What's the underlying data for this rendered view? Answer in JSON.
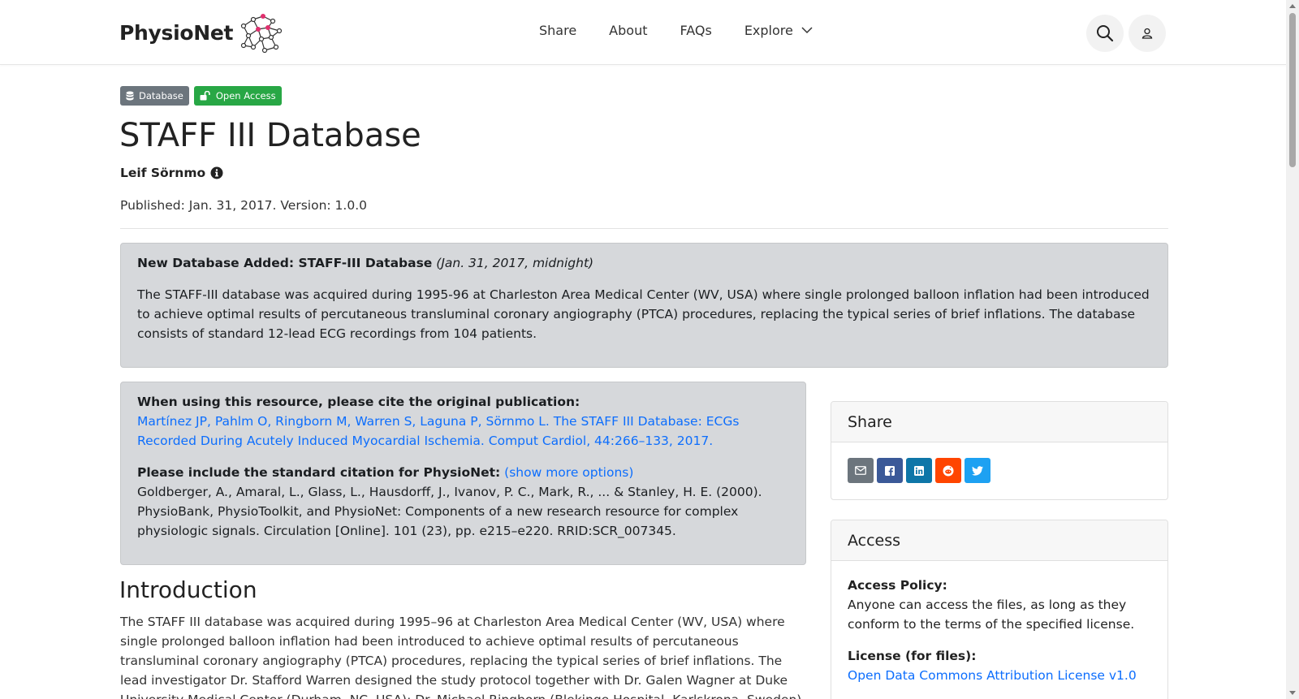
{
  "header": {
    "logo_text": "PhysioNet",
    "nav": {
      "share": "Share",
      "about": "About",
      "faqs": "FAQs",
      "explore": "Explore"
    },
    "icons": {
      "search": "search-icon",
      "user": "user-icon",
      "explore_caret": "chevron-down-icon"
    }
  },
  "badges": {
    "database": "Database",
    "open_access": "Open Access"
  },
  "project": {
    "title": "STAFF III Database",
    "author": "Leif Sörnmo",
    "published": "Published: Jan. 31, 2017. Version: 1.0.0"
  },
  "news": {
    "heading": "New Database Added: STAFF-III Database",
    "date": "(Jan. 31, 2017, midnight)",
    "body": "The STAFF-III database was acquired during 1995-96 at Charleston Area Medical Center (WV, USA) where single prolonged balloon inflation had been introduced to achieve optimal results of percutaneous transluminal coronary angiography (PTCA) procedures, replacing the typical series of brief inflations. The database consists of standard 12-lead ECG recordings from 104 patients."
  },
  "citation": {
    "original_label": "When using this resource, please cite the original publication:",
    "original_link": "Martínez JP, Pahlm O, Ringborn M, Warren S, Laguna P, Sörnmo L. The STAFF III Database: ECGs Recorded During Acutely Induced Myocardial Ischemia. Comput Cardiol, 44:266–133, 2017.",
    "standard_label": "Please include the standard citation for PhysioNet:",
    "more_options": "(show more options)",
    "standard_text": "Goldberger, A., Amaral, L., Glass, L., Hausdorff, J., Ivanov, P. C., Mark, R., ... & Stanley, H. E. (2000). PhysioBank, PhysioToolkit, and PhysioNet: Components of a new research resource for complex physiologic signals. Circulation [Online]. 101 (23), pp. e215–e220. RRID:SCR_007345."
  },
  "introduction": {
    "heading": "Introduction",
    "body": "The STAFF III database was acquired during 1995–96 at Charleston Area Medical Center (WV, USA) where single prolonged balloon inflation had been introduced to achieve optimal results of percutaneous transluminal coronary angiography (PTCA) procedures, replacing the typical series of brief inflations. The lead investigator Dr. Stafford Warren designed the study protocol together with Dr. Galen Wagner at Duke University Medical Center (Durham, NC, USA); Dr. Michael Ringborn (Blekinge Hospital, Karlskrona, Sweden) was responsible for"
  },
  "share_card": {
    "title": "Share",
    "buttons": [
      {
        "icon": "email-icon",
        "color": "#6c757d"
      },
      {
        "icon": "facebook-icon",
        "color": "#3b5998"
      },
      {
        "icon": "linkedin-icon",
        "color": "#0e76a8"
      },
      {
        "icon": "reddit-icon",
        "color": "#ff4500"
      },
      {
        "icon": "twitter-icon",
        "color": "#1da1f2"
      }
    ]
  },
  "access_card": {
    "title": "Access",
    "policy_label": "Access Policy:",
    "policy_text": "Anyone can access the files, as long as they conform to the terms of the specified license.",
    "license_label": "License (for files):",
    "license_link": "Open Data Commons Attribution License v1.0"
  },
  "colors": {
    "link": "#0d6efd",
    "badge_database": "#6c757d",
    "badge_open_access": "#28a745",
    "alert_bg": "#d6d8db"
  }
}
